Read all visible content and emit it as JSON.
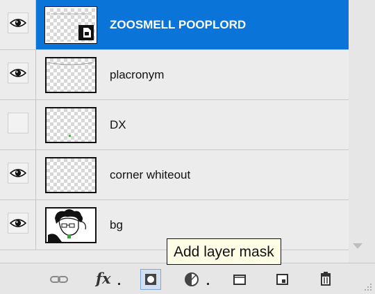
{
  "layers": [
    {
      "name": "ZOOSMELL POOPLORD",
      "visible": true,
      "selected": true,
      "thumbnail": "smart-object"
    },
    {
      "name": "placronym",
      "visible": true,
      "selected": false,
      "thumbnail": "transparent-border"
    },
    {
      "name": "DX",
      "visible": false,
      "selected": false,
      "thumbnail": "transparent-dot"
    },
    {
      "name": "corner whiteout",
      "visible": true,
      "selected": false,
      "thumbnail": "transparent"
    },
    {
      "name": "bg",
      "visible": true,
      "selected": false,
      "thumbnail": "drawing"
    }
  ],
  "toolbar": {
    "buttons": [
      {
        "icon": "link-icon"
      },
      {
        "icon": "fx-icon",
        "label": "fx"
      },
      {
        "icon": "layer-mask-icon"
      },
      {
        "icon": "adjustment-layer-icon"
      },
      {
        "icon": "group-folder-icon"
      },
      {
        "icon": "new-layer-icon"
      },
      {
        "icon": "trash-icon"
      }
    ]
  },
  "tooltip": {
    "text": "Add layer mask"
  }
}
